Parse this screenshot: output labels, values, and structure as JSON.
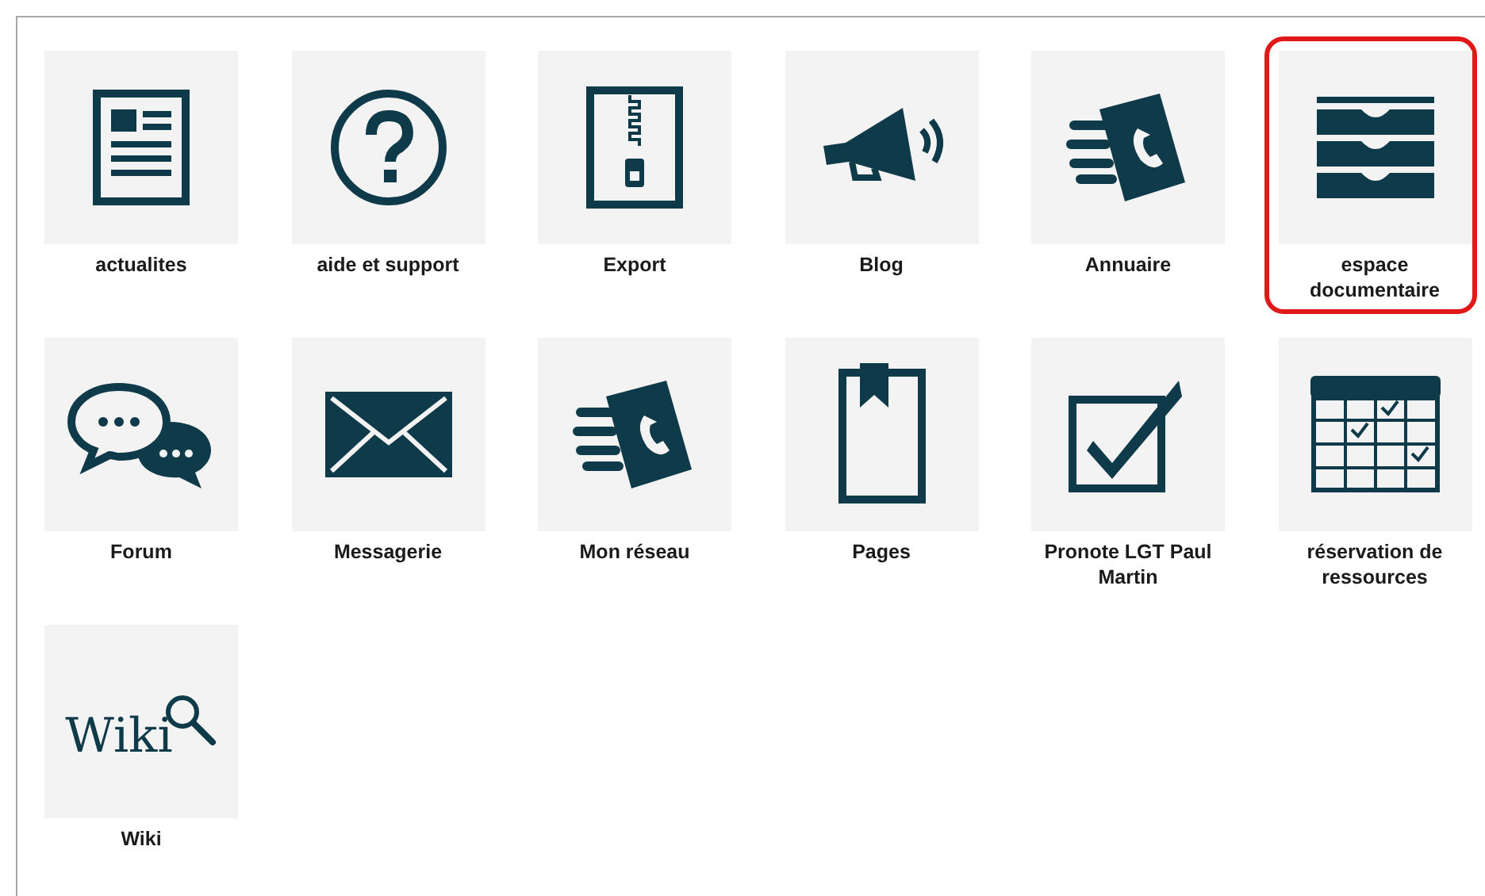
{
  "apps": [
    {
      "kind": "news",
      "label": "actualites",
      "selected": false
    },
    {
      "kind": "help",
      "label": "aide et support",
      "selected": false
    },
    {
      "kind": "zip",
      "label": "Export",
      "selected": false
    },
    {
      "kind": "megaphone",
      "label": "Blog",
      "selected": false
    },
    {
      "kind": "phonebook",
      "label": "Annuaire",
      "selected": false
    },
    {
      "kind": "drawers",
      "label": "espace documentaire",
      "selected": true
    },
    {
      "kind": "chat",
      "label": "Forum",
      "selected": false
    },
    {
      "kind": "mail",
      "label": "Messagerie",
      "selected": false
    },
    {
      "kind": "phonebook",
      "label": "Mon réseau",
      "selected": false
    },
    {
      "kind": "bookmark",
      "label": "Pages",
      "selected": false
    },
    {
      "kind": "checkbox",
      "label": "Pronote LGT Paul Martin",
      "selected": false
    },
    {
      "kind": "calendar",
      "label": "réservation de ressources",
      "selected": false
    },
    {
      "kind": "wiki",
      "label": "Wiki",
      "icon_text": "Wiki",
      "selected": false
    }
  ]
}
